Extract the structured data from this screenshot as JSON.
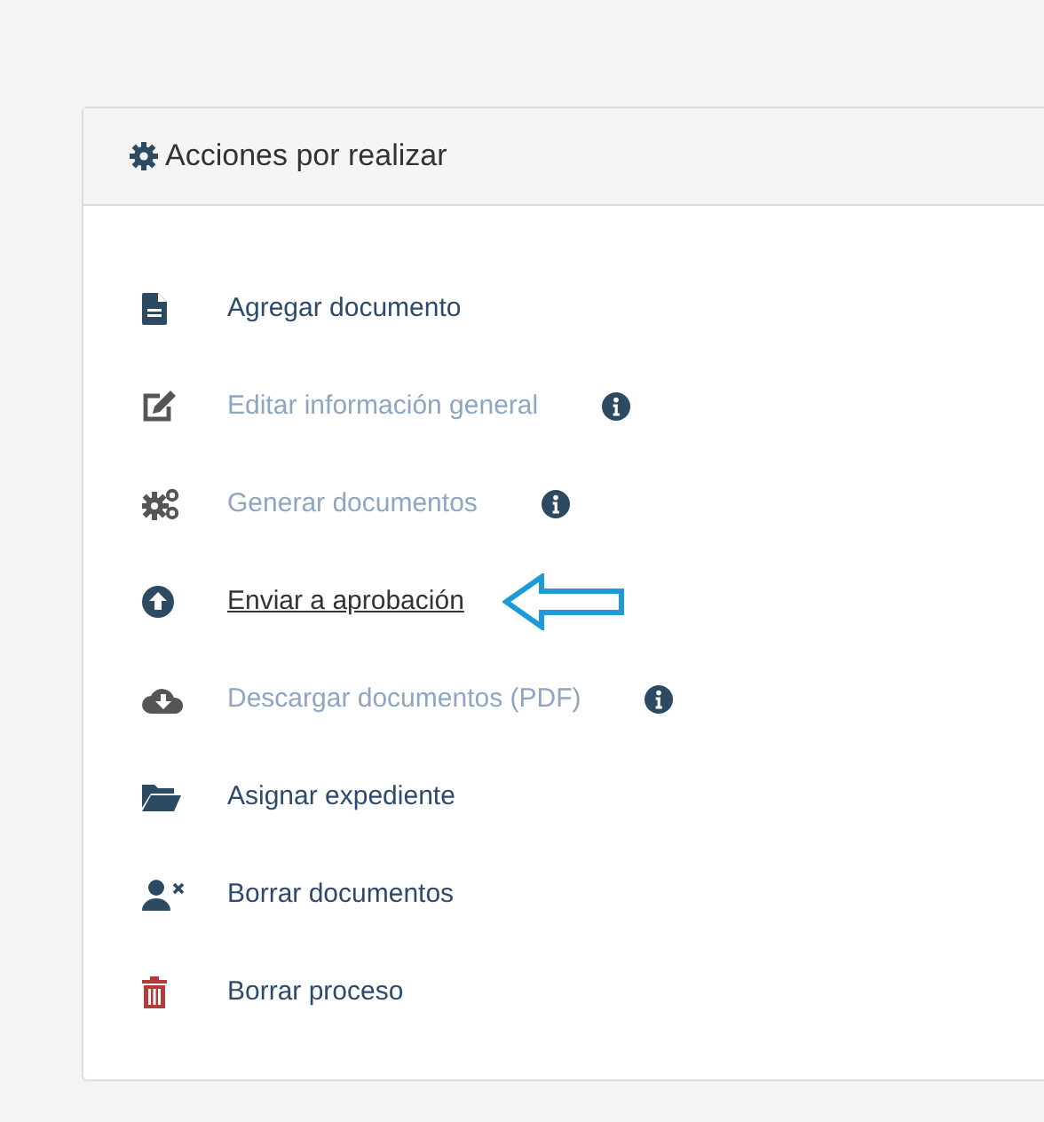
{
  "panel": {
    "title": "Acciones por realizar"
  },
  "actions": [
    {
      "kind": "file",
      "label": "Agregar documento",
      "disabled": false,
      "hovered": false,
      "info": false,
      "pointed": false
    },
    {
      "kind": "edit",
      "label": "Editar información general",
      "disabled": true,
      "hovered": false,
      "info": true,
      "pointed": false
    },
    {
      "kind": "cogs",
      "label": "Generar documentos",
      "disabled": true,
      "hovered": false,
      "info": true,
      "pointed": false
    },
    {
      "kind": "upload",
      "label": "Enviar a aprobación",
      "disabled": false,
      "hovered": true,
      "info": false,
      "pointed": true
    },
    {
      "kind": "download",
      "label": "Descargar documentos (PDF)",
      "disabled": true,
      "hovered": false,
      "info": true,
      "pointed": false
    },
    {
      "kind": "folder",
      "label": "Asignar expediente",
      "disabled": false,
      "hovered": false,
      "info": false,
      "pointed": false
    },
    {
      "kind": "unassign",
      "label": "Borrar documentos",
      "disabled": false,
      "hovered": false,
      "info": false,
      "pointed": false
    },
    {
      "kind": "trash",
      "label": "Borrar proceso",
      "disabled": false,
      "hovered": false,
      "info": false,
      "pointed": false
    }
  ]
}
